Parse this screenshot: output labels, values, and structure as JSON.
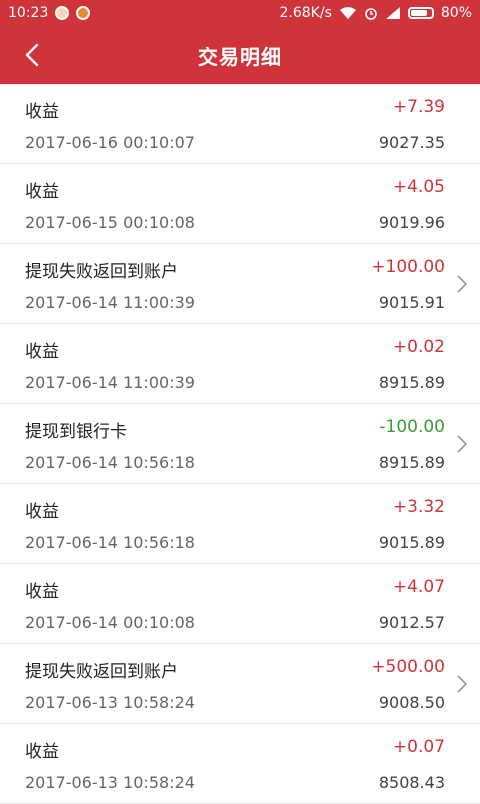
{
  "status_bar": {
    "time": "10:23",
    "network_speed": "2.68K/s",
    "battery": "80%",
    "battery_level": 0.8
  },
  "header": {
    "title": "交易明细"
  },
  "transactions": [
    {
      "name": "收益",
      "time": "2017-06-16 00:10:07",
      "amount": "+7.39",
      "balance": "9027.35",
      "type": "pos",
      "has_detail": false
    },
    {
      "name": "收益",
      "time": "2017-06-15 00:10:08",
      "amount": "+4.05",
      "balance": "9019.96",
      "type": "pos",
      "has_detail": false
    },
    {
      "name": "提现失败返回到账户",
      "time": "2017-06-14 11:00:39",
      "amount": "+100.00",
      "balance": "9015.91",
      "type": "pos",
      "has_detail": true
    },
    {
      "name": "收益",
      "time": "2017-06-14 11:00:39",
      "amount": "+0.02",
      "balance": "8915.89",
      "type": "pos",
      "has_detail": false
    },
    {
      "name": "提现到银行卡",
      "time": "2017-06-14 10:56:18",
      "amount": "-100.00",
      "balance": "8915.89",
      "type": "neg",
      "has_detail": true
    },
    {
      "name": "收益",
      "time": "2017-06-14 10:56:18",
      "amount": "+3.32",
      "balance": "9015.89",
      "type": "pos",
      "has_detail": false
    },
    {
      "name": "收益",
      "time": "2017-06-14 00:10:08",
      "amount": "+4.07",
      "balance": "9012.57",
      "type": "pos",
      "has_detail": false
    },
    {
      "name": "提现失败返回到账户",
      "time": "2017-06-13 10:58:24",
      "amount": "+500.00",
      "balance": "9008.50",
      "type": "pos",
      "has_detail": true
    },
    {
      "name": "收益",
      "time": "2017-06-13 10:58:24",
      "amount": "+0.07",
      "balance": "8508.43",
      "type": "pos",
      "has_detail": false
    }
  ],
  "colors": {
    "brand": "#d0343b",
    "positive": "#d0343b",
    "negative": "#3a9b3a"
  }
}
